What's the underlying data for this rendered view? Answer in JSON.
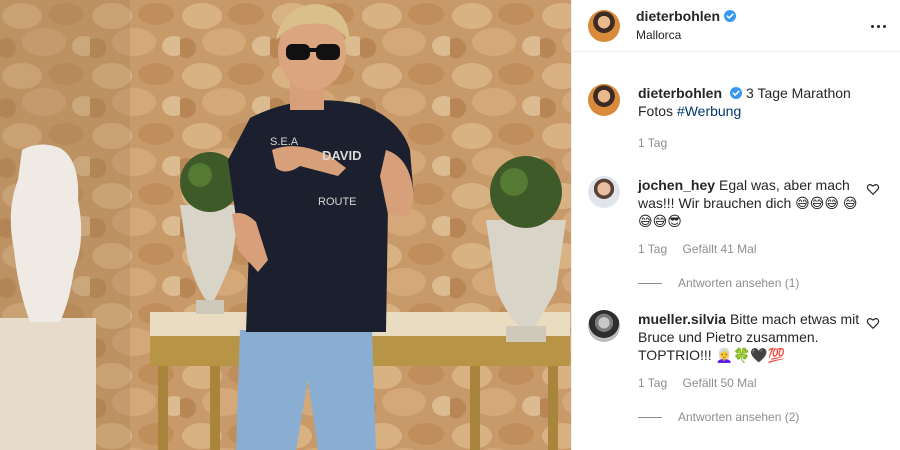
{
  "post": {
    "username": "dieterbohlen",
    "location": "Mallorca",
    "caption": "3 Tage Marathon Fotos",
    "hashtag": "#Werbung",
    "caption_time": "1 Tag"
  },
  "comments": [
    {
      "username": "jochen_hey",
      "text": "Egal was, aber mach was!!! Wir brauchen dich 😅😅😅 😅😅😅😎",
      "time": "1 Tag",
      "likes": "Gefällt 41 Mal",
      "replies": "Antworten ansehen (1)"
    },
    {
      "username": "mueller.silvia",
      "text": "Bitte mach etwas mit Bruce und Pietro zusammen. TOPTRIO!!! 👩‍🦳🍀🖤💯",
      "time": "1 Tag",
      "likes": "Gefällt 50 Mal",
      "replies": "Antworten ansehen (2)"
    }
  ],
  "colors": {
    "verified": "#3897f0",
    "hashtag": "#00376b",
    "muted": "#8e8e8e"
  },
  "icons": [
    "verified-icon",
    "more-options-icon",
    "heart-icon"
  ]
}
